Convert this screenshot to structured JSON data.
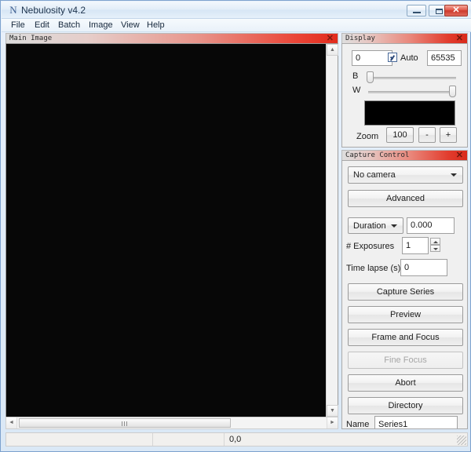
{
  "window": {
    "title": "Nebulosity v4.2",
    "logo_glyph": "N",
    "minimize_label": "",
    "maximize_label": "",
    "close_label": "✕"
  },
  "menubar": {
    "items": [
      {
        "label": "File"
      },
      {
        "label": "Edit"
      },
      {
        "label": "Batch"
      },
      {
        "label": "Image"
      },
      {
        "label": "View"
      },
      {
        "label": "Help"
      }
    ]
  },
  "image_panel": {
    "caption": "Main Image",
    "close_label": "✕",
    "scroll_up": "▲",
    "scroll_down": "▼",
    "scroll_left": "◄",
    "scroll_right": "►"
  },
  "display_panel": {
    "caption": "Display",
    "close_label": "✕",
    "black_value": "0",
    "white_value": "65535",
    "auto_label": "Auto",
    "auto_checked": true,
    "b_label": "B",
    "w_label": "W",
    "zoom_label": "Zoom",
    "zoom_value": "100",
    "zoom_minus": "-",
    "zoom_plus": "+"
  },
  "capture_panel": {
    "caption": "Capture Control",
    "close_label": "✕",
    "camera_select": "No camera",
    "advanced_label": "Advanced",
    "duration_mode": "Duration",
    "duration_value": "0.000",
    "exposures_label": "# Exposures",
    "exposures_value": "1",
    "timelapse_label": "Time lapse (s)",
    "timelapse_value": "0",
    "buttons": [
      {
        "label": "Capture Series",
        "enabled": true
      },
      {
        "label": "Preview",
        "enabled": true
      },
      {
        "label": "Frame and Focus",
        "enabled": true
      },
      {
        "label": "Fine Focus",
        "enabled": false
      },
      {
        "label": "Abort",
        "enabled": true
      },
      {
        "label": "Directory",
        "enabled": true
      }
    ],
    "name_label": "Name",
    "name_value": "Series1"
  },
  "statusbar": {
    "cell1": "",
    "cell2": "",
    "coordinates": "0,0"
  },
  "colors": {
    "caption_red": "#e22b1c",
    "panel_bg": "#f0f0f0",
    "canvas_black": "#070707",
    "close_btn_red": "#cd3a2c"
  }
}
